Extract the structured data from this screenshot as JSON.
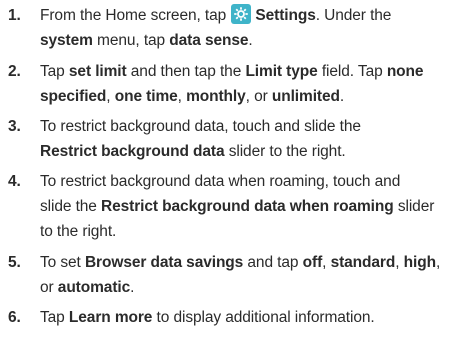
{
  "steps": [
    {
      "number": "1.",
      "lines": [
        [
          "From the Home screen, tap ",
          "Settings",
          ". Under the"
        ],
        [
          "system",
          " menu, tap ",
          "data sense",
          "."
        ]
      ],
      "icon": "settings-gear-icon",
      "icon_color": "#3fb4c9"
    },
    {
      "number": "2.",
      "lines": [
        [
          "Tap ",
          "set limit",
          " and then tap the ",
          "Limit type",
          " field. Tap ",
          "none"
        ],
        [
          "specified",
          ", ",
          "one time",
          ", ",
          "monthly",
          ", or ",
          "unlimited",
          "."
        ]
      ]
    },
    {
      "number": "3.",
      "lines": [
        [
          "To restrict background data, touch and slide the"
        ],
        [
          "Restrict background data",
          " slider to the right."
        ]
      ]
    },
    {
      "number": "4.",
      "lines": [
        [
          "To restrict background data when roaming, touch and"
        ],
        [
          "slide the ",
          "Restrict background data when roaming",
          " slider"
        ],
        [
          "to the right."
        ]
      ]
    },
    {
      "number": "5.",
      "lines": [
        [
          "To set ",
          "Browser data savings",
          " and tap ",
          "off",
          ", ",
          "standard",
          ", ",
          "high",
          ","
        ],
        [
          "or ",
          "automatic",
          "."
        ]
      ]
    },
    {
      "number": "6.",
      "lines": [
        [
          "Tap ",
          "Learn more",
          " to display additional information."
        ]
      ]
    }
  ]
}
